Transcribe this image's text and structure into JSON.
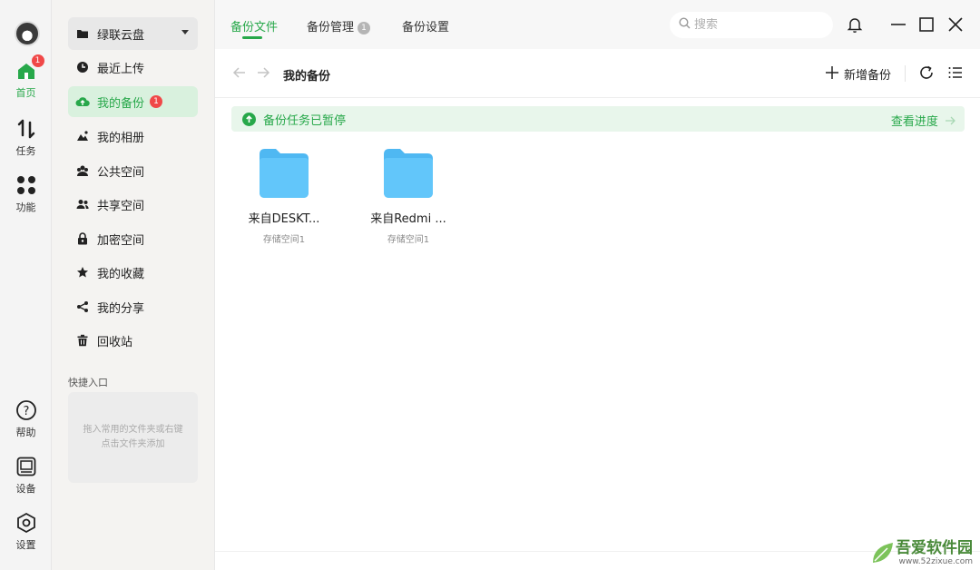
{
  "rail": {
    "badge_count": "1",
    "items": [
      {
        "label": "首页",
        "icon": "home-icon"
      },
      {
        "label": "任务",
        "icon": "transfer-icon"
      },
      {
        "label": "功能",
        "icon": "apps-icon"
      },
      {
        "label": "帮助",
        "icon": "help-icon"
      },
      {
        "label": "设备",
        "icon": "device-icon"
      },
      {
        "label": "设置",
        "icon": "settings-icon"
      }
    ]
  },
  "sidenav": {
    "drive_label": "绿联云盘",
    "items": [
      {
        "label": "最近上传",
        "icon": "clock-icon"
      },
      {
        "label": "我的备份",
        "icon": "cloud-upload-icon",
        "badge": "1"
      },
      {
        "label": "我的相册",
        "icon": "mountain-icon"
      },
      {
        "label": "公共空间",
        "icon": "group-icon"
      },
      {
        "label": "共享空间",
        "icon": "users-icon"
      },
      {
        "label": "加密空间",
        "icon": "lock-icon"
      },
      {
        "label": "我的收藏",
        "icon": "star-icon"
      },
      {
        "label": "我的分享",
        "icon": "share-icon"
      },
      {
        "label": "回收站",
        "icon": "trash-icon"
      }
    ],
    "quick_title": "快捷入口",
    "quick_hint": "拖入常用的文件夹或右键点击文件夹添加"
  },
  "topbar": {
    "tabs": [
      {
        "label": "备份文件",
        "active": true
      },
      {
        "label": "备份管理",
        "badge": "1"
      },
      {
        "label": "备份设置"
      }
    ],
    "search_placeholder": "搜索"
  },
  "pathbar": {
    "title": "我的备份",
    "add_label": "新增备份"
  },
  "banner": {
    "status": "备份任务已暂停",
    "action": "查看进度"
  },
  "folders": [
    {
      "name": "来自DESKT...",
      "sub": "存储空间1"
    },
    {
      "name": "来自Redmi ...",
      "sub": "存储空间1"
    }
  ],
  "watermark": {
    "brand": "吾爱软件园",
    "url": "www.52zixue.com"
  },
  "colors": {
    "accent": "#27a84a",
    "badge": "#f04848",
    "folder": "#5ec3f7"
  }
}
